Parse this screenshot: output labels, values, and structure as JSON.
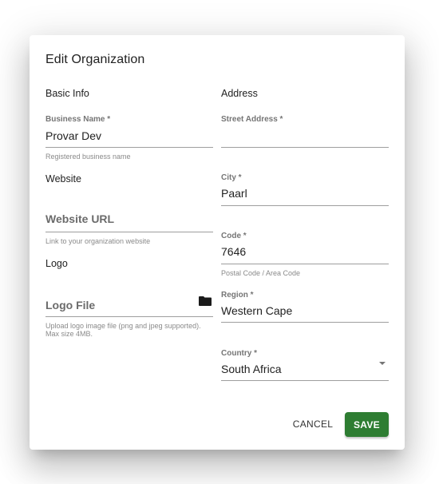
{
  "dialog": {
    "title": "Edit Organization"
  },
  "basic_info": {
    "heading": "Basic Info",
    "business_name": {
      "label": "Business Name *",
      "value": "Provar Dev",
      "hint": "Registered business name"
    },
    "website_heading": "Website",
    "website_url": {
      "placeholder": "Website URL",
      "hint": "Link to your organization website"
    },
    "logo_heading": "Logo",
    "logo_file": {
      "placeholder": "Logo File",
      "icon": "folder-icon",
      "hint": "Upload logo image file (png and jpeg supported). Max size 4MB."
    }
  },
  "address": {
    "heading": "Address",
    "street_address": {
      "label": "Street Address *",
      "value": ""
    },
    "city": {
      "label": "City *",
      "value": "Paarl"
    },
    "code": {
      "label": "Code *",
      "value": "7646",
      "hint": "Postal Code / Area Code"
    },
    "region": {
      "label": "Region *",
      "value": "Western Cape"
    },
    "country": {
      "label": "Country *",
      "value": "South Africa",
      "icon": "dropdown-arrow-icon"
    }
  },
  "actions": {
    "cancel_label": "CANCEL",
    "save_label": "SAVE"
  },
  "colors": {
    "primary": "#2e7d32"
  }
}
